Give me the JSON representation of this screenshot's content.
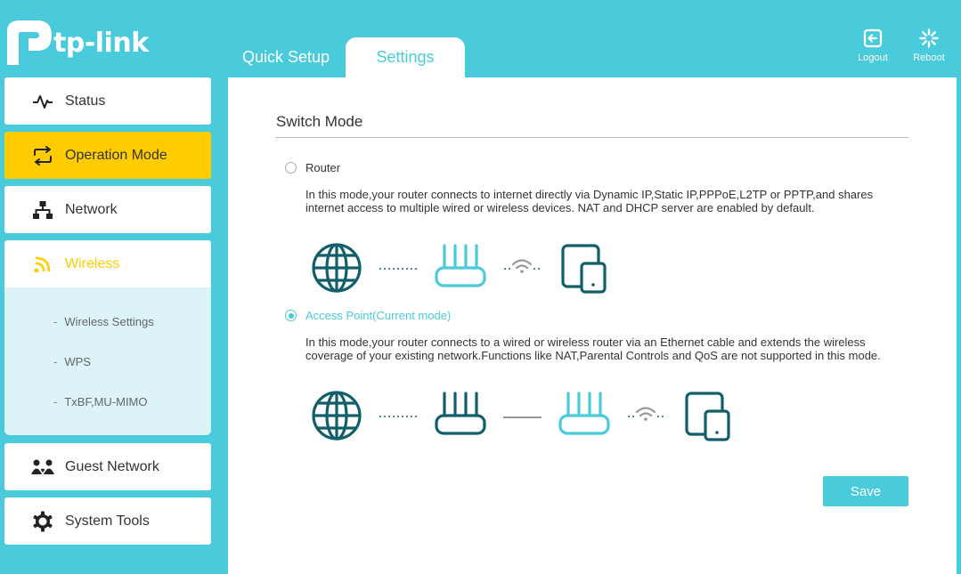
{
  "brand": {
    "logo_text": "tp-link"
  },
  "tabs": [
    {
      "label": "Quick Setup",
      "active": false
    },
    {
      "label": "Settings",
      "active": true
    }
  ],
  "header_buttons": {
    "logout": "Logout",
    "reboot": "Reboot"
  },
  "sidebar": {
    "items": [
      {
        "label": "Status",
        "icon": "status-pulse-icon"
      },
      {
        "label": "Operation Mode",
        "icon": "operation-mode-icon",
        "active": true
      },
      {
        "label": "Network",
        "icon": "network-icon"
      },
      {
        "label": "Wireless",
        "icon": "wireless-icon",
        "expanded": true
      },
      {
        "label": "Guest Network",
        "icon": "guest-network-icon"
      },
      {
        "label": "System Tools",
        "icon": "gear-icon"
      }
    ],
    "wireless_sub": [
      "Wireless Settings",
      "WPS",
      "TxBF,MU-MIMO"
    ]
  },
  "main": {
    "section_title": "Switch Mode",
    "modes": [
      {
        "label": "Router",
        "selected": false,
        "description": "In this mode,your router connects to internet directly via Dynamic IP,Static IP,PPPoE,L2TP or PPTP,and shares internet access to multiple wired or wireless devices. NAT and DHCP server are enabled by default."
      },
      {
        "label": "Access Point(Current mode)",
        "selected": true,
        "description": "In this mode,your router connects to a wired or wireless router via an Ethernet cable and extends the wireless coverage of your existing network.Functions like NAT,Parental Controls and QoS are not supported in this mode."
      }
    ],
    "save_label": "Save"
  },
  "colors": {
    "accent": "#4acbdb",
    "active": "#ffcc00",
    "dark_teal": "#105f6a",
    "submenu_bg": "#dcf4f8"
  }
}
